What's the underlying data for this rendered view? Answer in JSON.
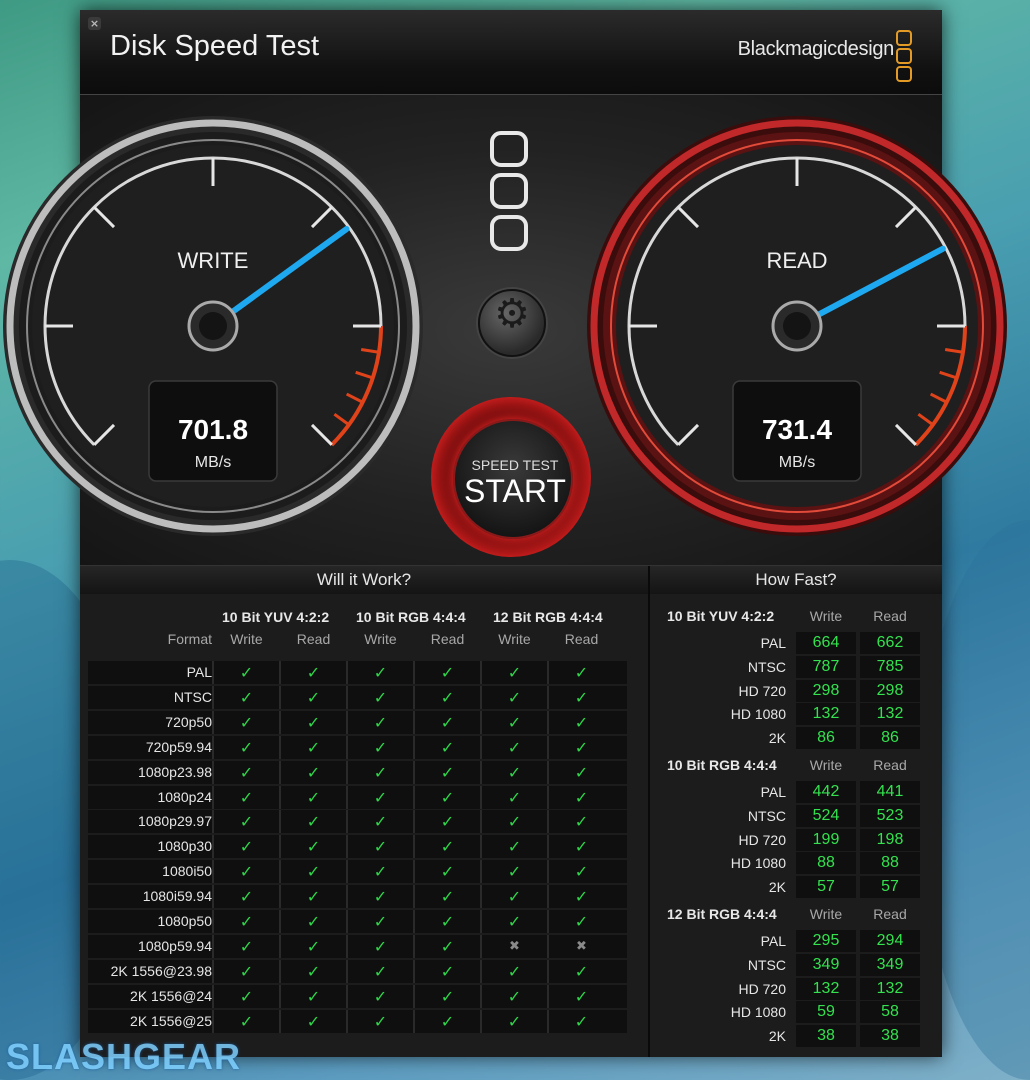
{
  "window": {
    "title": "Disk Speed Test",
    "brand": "Blackmagicdesign",
    "close_symbol": "×"
  },
  "gauges": {
    "write": {
      "label": "WRITE",
      "value": "701.8",
      "unit": "MB/s",
      "fraction": 0.7
    },
    "read": {
      "label": "READ",
      "value": "731.4",
      "unit": "MB/s",
      "fraction": 0.73
    }
  },
  "start_button": {
    "top_label": "SPEED TEST",
    "main_label": "START"
  },
  "will_it_work": {
    "title": "Will it Work?",
    "format_header": "Format",
    "groups": [
      "10 Bit YUV 4:2:2",
      "10 Bit RGB 4:4:4",
      "12 Bit RGB 4:4:4"
    ],
    "sub_headers": [
      "Write",
      "Read",
      "Write",
      "Read",
      "Write",
      "Read"
    ],
    "rows": [
      {
        "format": "PAL",
        "cells": [
          1,
          1,
          1,
          1,
          1,
          1
        ]
      },
      {
        "format": "NTSC",
        "cells": [
          1,
          1,
          1,
          1,
          1,
          1
        ]
      },
      {
        "format": "720p50",
        "cells": [
          1,
          1,
          1,
          1,
          1,
          1
        ]
      },
      {
        "format": "720p59.94",
        "cells": [
          1,
          1,
          1,
          1,
          1,
          1
        ]
      },
      {
        "format": "1080p23.98",
        "cells": [
          1,
          1,
          1,
          1,
          1,
          1
        ]
      },
      {
        "format": "1080p24",
        "cells": [
          1,
          1,
          1,
          1,
          1,
          1
        ]
      },
      {
        "format": "1080p29.97",
        "cells": [
          1,
          1,
          1,
          1,
          1,
          1
        ]
      },
      {
        "format": "1080p30",
        "cells": [
          1,
          1,
          1,
          1,
          1,
          1
        ]
      },
      {
        "format": "1080i50",
        "cells": [
          1,
          1,
          1,
          1,
          1,
          1
        ]
      },
      {
        "format": "1080i59.94",
        "cells": [
          1,
          1,
          1,
          1,
          1,
          1
        ]
      },
      {
        "format": "1080p50",
        "cells": [
          1,
          1,
          1,
          1,
          1,
          1
        ]
      },
      {
        "format": "1080p59.94",
        "cells": [
          1,
          1,
          1,
          1,
          0,
          0
        ]
      },
      {
        "format": "2K 1556@23.98",
        "cells": [
          1,
          1,
          1,
          1,
          1,
          1
        ]
      },
      {
        "format": "2K 1556@24",
        "cells": [
          1,
          1,
          1,
          1,
          1,
          1
        ]
      },
      {
        "format": "2K 1556@25",
        "cells": [
          1,
          1,
          1,
          1,
          1,
          1
        ]
      }
    ],
    "check_symbol": "✓",
    "cross_symbol": "✖"
  },
  "how_fast": {
    "title": "How Fast?",
    "write_header": "Write",
    "read_header": "Read",
    "groups": [
      {
        "name": "10 Bit YUV 4:2:2",
        "rows": [
          {
            "format": "PAL",
            "write": "664",
            "read": "662"
          },
          {
            "format": "NTSC",
            "write": "787",
            "read": "785"
          },
          {
            "format": "HD 720",
            "write": "298",
            "read": "298"
          },
          {
            "format": "HD 1080",
            "write": "132",
            "read": "132"
          },
          {
            "format": "2K",
            "write": "86",
            "read": "86"
          }
        ]
      },
      {
        "name": "10 Bit RGB 4:4:4",
        "rows": [
          {
            "format": "PAL",
            "write": "442",
            "read": "441"
          },
          {
            "format": "NTSC",
            "write": "524",
            "read": "523"
          },
          {
            "format": "HD 720",
            "write": "199",
            "read": "198"
          },
          {
            "format": "HD 1080",
            "write": "88",
            "read": "88"
          },
          {
            "format": "2K",
            "write": "57",
            "read": "57"
          }
        ]
      },
      {
        "name": "12 Bit RGB 4:4:4",
        "rows": [
          {
            "format": "PAL",
            "write": "295",
            "read": "294"
          },
          {
            "format": "NTSC",
            "write": "349",
            "read": "349"
          },
          {
            "format": "HD 720",
            "write": "132",
            "read": "132"
          },
          {
            "format": "HD 1080",
            "write": "59",
            "read": "58"
          },
          {
            "format": "2K",
            "write": "38",
            "read": "38"
          }
        ]
      }
    ]
  },
  "watermark": "SLASHGEAR",
  "colors": {
    "accent_green": "#33e24e",
    "needle": "#1ea8f0",
    "redline": "#e0431a",
    "logo": "#e39b25"
  }
}
